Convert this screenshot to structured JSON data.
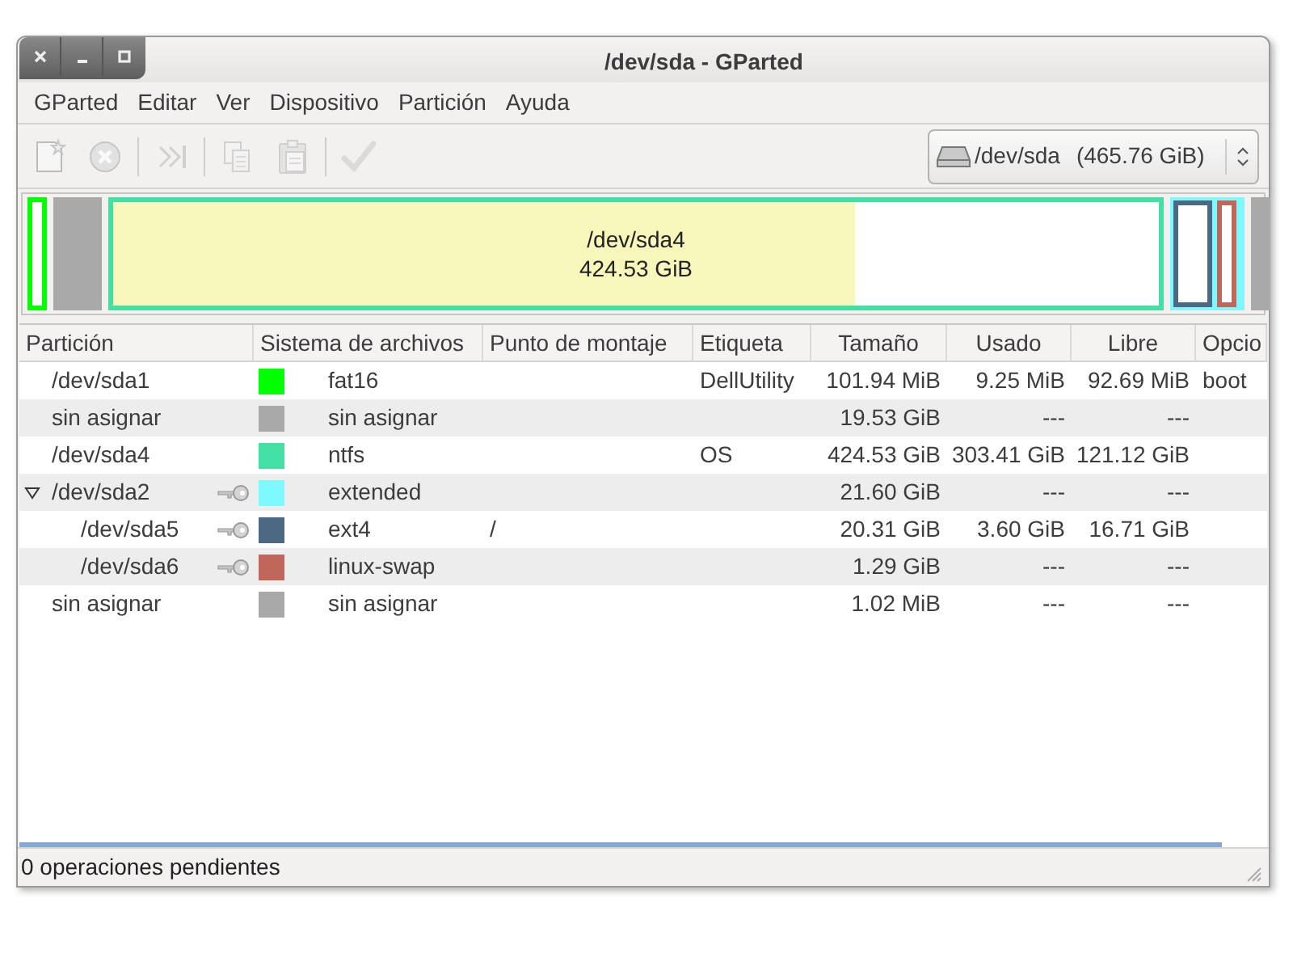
{
  "window": {
    "title": "/dev/sda - GParted"
  },
  "menu": [
    "GParted",
    "Editar",
    "Ver",
    "Dispositivo",
    "Partición",
    "Ayuda"
  ],
  "toolbar": [
    {
      "kind": "new",
      "disabled": true
    },
    {
      "kind": "delete",
      "disabled": true
    },
    {
      "kind": "separator"
    },
    {
      "kind": "resize",
      "disabled": true
    },
    {
      "kind": "separator"
    },
    {
      "kind": "copy",
      "disabled": true
    },
    {
      "kind": "paste",
      "disabled": true
    },
    {
      "kind": "separator"
    },
    {
      "kind": "apply",
      "disabled": true
    }
  ],
  "device": {
    "label": "/dev/sda",
    "size": "(465.76 GiB)"
  },
  "disk_map": [
    {
      "kind": "partition",
      "color": "#00ff00"
    },
    {
      "kind": "unallocated",
      "color": "#a9a9a9"
    },
    {
      "kind": "partition",
      "color": "#43e0a6",
      "level": 0.71,
      "name": "/dev/sda4",
      "size": "424.53 GiB"
    },
    {
      "kind": "extended",
      "color": "#7df9ff",
      "children": [
        {
          "kind": "partition",
          "color": "#4b6983"
        },
        {
          "kind": "partition",
          "color": "#c1665a"
        }
      ]
    },
    {
      "kind": "unallocated",
      "color": "#a9a9a9"
    }
  ],
  "table": {
    "columns": [
      "Partición",
      "Sistema de archivos",
      "Punto de montaje",
      "Etiqueta",
      "Tamaño",
      "Usado",
      "Libre",
      "Opcio"
    ],
    "rows": [
      {
        "partition": "/dev/sda1",
        "mounted": false,
        "color": "#00ff00",
        "filesystem": "fat16",
        "label": "DellUtility",
        "size": "101.94 MiB",
        "used": "9.25 MiB",
        "free": "92.69 MiB",
        "flags": "boot"
      },
      {
        "partition": "sin asignar",
        "mounted": false,
        "color": "#a9a9a9",
        "filesystem": "sin asignar",
        "size": "19.53 GiB",
        "used": "---",
        "free": "---"
      },
      {
        "partition": "/dev/sda4",
        "mounted": false,
        "color": "#43e0a6",
        "filesystem": "ntfs",
        "label": "OS",
        "size": "424.53 GiB",
        "used": "303.41 GiB",
        "free": "121.12 GiB"
      },
      {
        "partition": "/dev/sda2",
        "mounted": true,
        "expanded": true,
        "color": "#7df9ff",
        "filesystem": "extended",
        "size": "21.60 GiB",
        "used": "---",
        "free": "---",
        "children": [
          {
            "partition": "/dev/sda5",
            "mounted": true,
            "color": "#4b6983",
            "filesystem": "ext4",
            "mount_point": "/",
            "size": "20.31 GiB",
            "used": "3.60 GiB",
            "free": "16.71 GiB"
          },
          {
            "partition": "/dev/sda6",
            "mounted": true,
            "color": "#c1665a",
            "filesystem": "linux-swap",
            "size": "1.29 GiB",
            "used": "---",
            "free": "---"
          }
        ]
      },
      {
        "partition": "sin asignar",
        "mounted": false,
        "color": "#a9a9a9",
        "filesystem": "sin asignar",
        "size": "1.02 MiB",
        "used": "---",
        "free": "---"
      }
    ]
  },
  "status_bar": "0 operaciones pendientes"
}
